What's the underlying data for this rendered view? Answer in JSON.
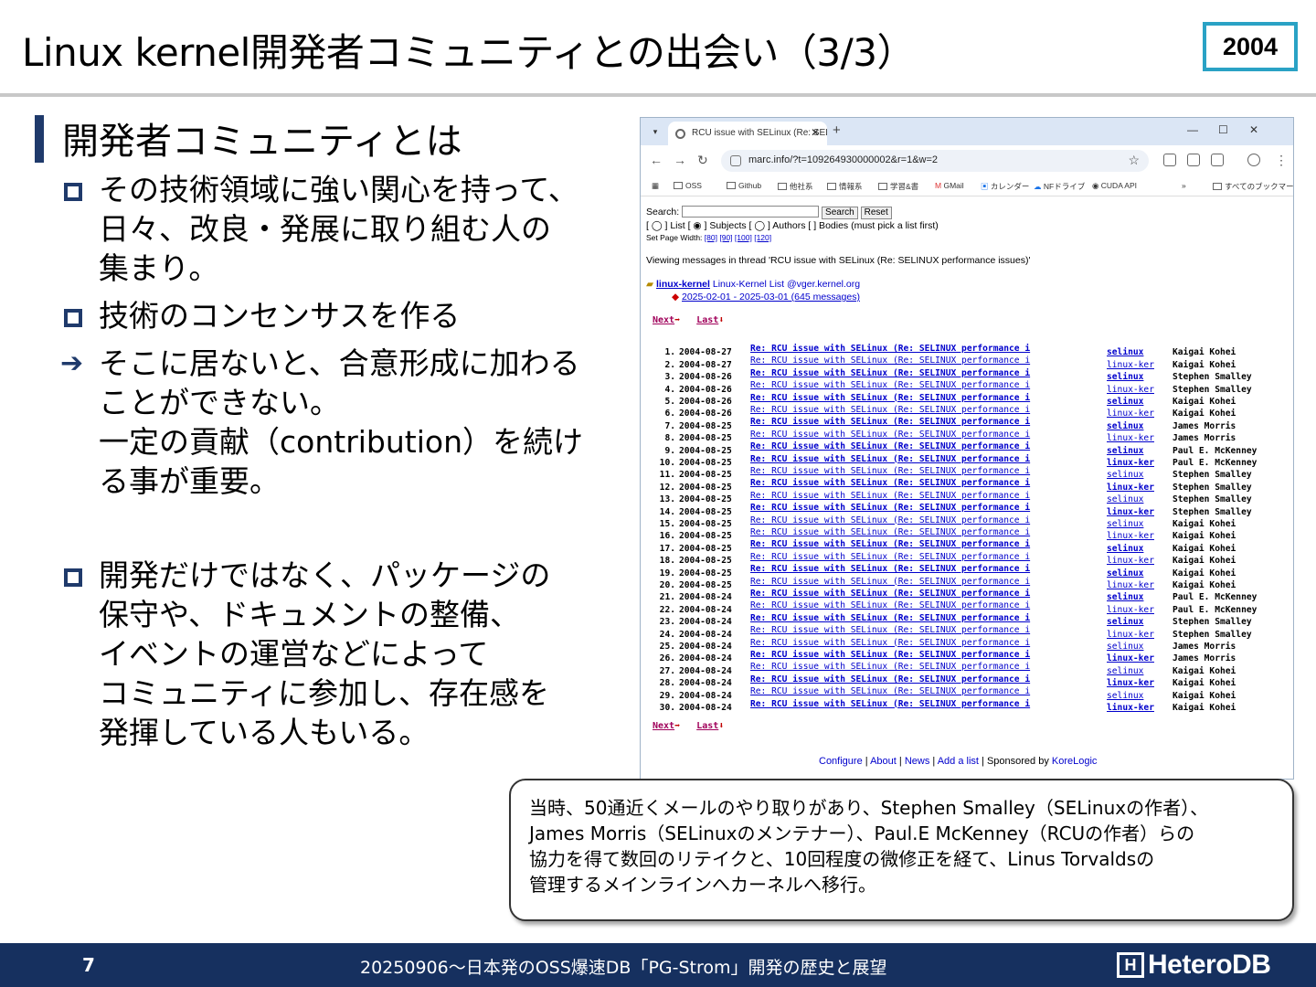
{
  "slide": {
    "title": "Linux kernel開発者コミュニティとの出会い（3/3）",
    "year_badge": "2004",
    "heading": "開発者コミュニティとは",
    "bullets": [
      {
        "lines": [
          "その技術領域に強い関心を持って、",
          "日々、改良・発展に取り組む人の",
          "集まり。"
        ]
      },
      {
        "lines": [
          "技術のコンセンサスを作る"
        ]
      },
      {
        "lines": [
          "そこに居ないと、合意形成に加わる",
          "ことができない。",
          "一定の貢献（contribution）を続け",
          "る事が重要。"
        ]
      },
      {
        "lines": [
          "開発だけではなく、パッケージの",
          "保守や、ドキュメントの整備、",
          "イベントの運営などによって",
          "コミュニティに参加し、存在感を",
          "発揮している人もいる。"
        ]
      }
    ],
    "callout_lines": [
      "当時、50通近くメールのやり取りがあり、Stephen Smalley（SELinuxの作者）、",
      "James Morris（SELinuxのメンテナー）、Paul.E McKenney（RCUの作者）らの",
      "協力を得て数回のリテイクと、10回程度の微修正を経て、Linus Torvaldsの",
      "管理するメインラインへカーネルへ移行。"
    ],
    "footer": {
      "page_number": "7",
      "text": "20250906～日本発のOSS爆速DB「PG-Strom」開発の歴史と展望",
      "logo_mark": "H",
      "logo_text": "HeteroDB"
    }
  },
  "browser": {
    "tab_title": "RCU issue with SELinux (Re: SELIN",
    "new_tab": "+",
    "url": "marc.info/?t=109264930000002&r=1&w=2",
    "window_controls": [
      "—",
      "☐",
      "✕"
    ],
    "bookmarks": [
      "OSS",
      "Github",
      "他社系",
      "情報系",
      "学習&書",
      "GMail",
      "カレンダー",
      "NFドライブ",
      "CUDA API",
      "すべてのブックマーク"
    ],
    "search_label": "Search:",
    "search_button": "Search",
    "reset_button": "Reset",
    "search_options": "[ ◯ ] List [ ◉ ] Subjects [ ◯ ] Authors [  ] Bodies (must pick a list first)",
    "page_width_label": "Set Page Width:",
    "page_widths": [
      "[80]",
      "[90]",
      "[100]",
      "[120]"
    ],
    "thread_heading": "Viewing messages in thread 'RCU issue with SELinux (Re: SELINUX performance issues)'",
    "list_name": "linux-kernel",
    "list_desc": "Linux-Kernel List @vger.kernel.org",
    "date_range": "2025-02-01 - 2025-03-01 (645 messages)",
    "next_label": "Next",
    "last_label": "Last",
    "messages": [
      {
        "num": "1.",
        "date": "2004-08-27",
        "subject": "Re: RCU issue with SELinux (Re: SELINUX performance i",
        "list": "selinux",
        "author": "Kaigai Kohei",
        "bold": true
      },
      {
        "num": "2.",
        "date": "2004-08-27",
        "subject": "Re: RCU issue with SELinux (Re: SELINUX performance i",
        "list": "linux-ker",
        "author": "Kaigai Kohei",
        "bold": false
      },
      {
        "num": "3.",
        "date": "2004-08-26",
        "subject": "Re: RCU issue with SELinux (Re: SELINUX performance i",
        "list": "selinux",
        "author": "Stephen Smalley",
        "bold": true
      },
      {
        "num": "4.",
        "date": "2004-08-26",
        "subject": "Re: RCU issue with SELinux (Re: SELINUX performance i",
        "list": "linux-ker",
        "author": "Stephen Smalley",
        "bold": false
      },
      {
        "num": "5.",
        "date": "2004-08-26",
        "subject": "Re: RCU issue with SELinux (Re: SELINUX performance i",
        "list": "selinux",
        "author": "Kaigai Kohei",
        "bold": true
      },
      {
        "num": "6.",
        "date": "2004-08-26",
        "subject": "Re: RCU issue with SELinux (Re: SELINUX performance i",
        "list": "linux-ker",
        "author": "Kaigai Kohei",
        "bold": false
      },
      {
        "num": "7.",
        "date": "2004-08-25",
        "subject": "Re: RCU issue with SELinux (Re: SELINUX performance i",
        "list": "selinux",
        "author": "James Morris",
        "bold": true
      },
      {
        "num": "8.",
        "date": "2004-08-25",
        "subject": "Re: RCU issue with SELinux (Re: SELINUX performance i",
        "list": "linux-ker",
        "author": "James Morris",
        "bold": false
      },
      {
        "num": "9.",
        "date": "2004-08-25",
        "subject": "Re: RCU issue with SELinux (Re: SELINUX performance i",
        "list": "selinux",
        "author": "Paul E. McKenney",
        "bold": true
      },
      {
        "num": "10.",
        "date": "2004-08-25",
        "subject": "Re: RCU issue with SELinux (Re: SELINUX performance i",
        "list": "linux-ker",
        "author": "Paul E. McKenney",
        "bold": true
      },
      {
        "num": "11.",
        "date": "2004-08-25",
        "subject": "Re: RCU issue with SELinux (Re: SELINUX performance i",
        "list": "selinux",
        "author": "Stephen Smalley",
        "bold": false
      },
      {
        "num": "12.",
        "date": "2004-08-25",
        "subject": "Re: RCU issue with SELinux (Re: SELINUX performance i",
        "list": "linux-ker",
        "author": "Stephen Smalley",
        "bold": true
      },
      {
        "num": "13.",
        "date": "2004-08-25",
        "subject": "Re: RCU issue with SELinux (Re: SELINUX performance i",
        "list": "selinux",
        "author": "Stephen Smalley",
        "bold": false
      },
      {
        "num": "14.",
        "date": "2004-08-25",
        "subject": "Re: RCU issue with SELinux (Re: SELINUX performance i",
        "list": "linux-ker",
        "author": "Stephen Smalley",
        "bold": true
      },
      {
        "num": "15.",
        "date": "2004-08-25",
        "subject": "Re: RCU issue with SELinux (Re: SELINUX performance i",
        "list": "selinux",
        "author": "Kaigai Kohei",
        "bold": false
      },
      {
        "num": "16.",
        "date": "2004-08-25",
        "subject": "Re: RCU issue with SELinux (Re: SELINUX performance i",
        "list": "linux-ker",
        "author": "Kaigai Kohei",
        "bold": false
      },
      {
        "num": "17.",
        "date": "2004-08-25",
        "subject": "Re: RCU issue with SELinux (Re: SELINUX performance i",
        "list": "selinux",
        "author": "Kaigai Kohei",
        "bold": true
      },
      {
        "num": "18.",
        "date": "2004-08-25",
        "subject": "Re: RCU issue with SELinux (Re: SELINUX performance i",
        "list": "linux-ker",
        "author": "Kaigai Kohei",
        "bold": false
      },
      {
        "num": "19.",
        "date": "2004-08-25",
        "subject": "Re: RCU issue with SELinux (Re: SELINUX performance i",
        "list": "selinux",
        "author": "Kaigai Kohei",
        "bold": true
      },
      {
        "num": "20.",
        "date": "2004-08-25",
        "subject": "Re: RCU issue with SELinux (Re: SELINUX performance i",
        "list": "linux-ker",
        "author": "Kaigai Kohei",
        "bold": false
      },
      {
        "num": "21.",
        "date": "2004-08-24",
        "subject": "Re: RCU issue with SELinux (Re: SELINUX performance i",
        "list": "selinux",
        "author": "Paul E. McKenney",
        "bold": true
      },
      {
        "num": "22.",
        "date": "2004-08-24",
        "subject": "Re: RCU issue with SELinux (Re: SELINUX performance i",
        "list": "linux-ker",
        "author": "Paul E. McKenney",
        "bold": false
      },
      {
        "num": "23.",
        "date": "2004-08-24",
        "subject": "Re: RCU issue with SELinux (Re: SELINUX performance i",
        "list": "selinux",
        "author": "Stephen Smalley",
        "bold": true
      },
      {
        "num": "24.",
        "date": "2004-08-24",
        "subject": "Re: RCU issue with SELinux (Re: SELINUX performance i",
        "list": "linux-ker",
        "author": "Stephen Smalley",
        "bold": false
      },
      {
        "num": "25.",
        "date": "2004-08-24",
        "subject": "Re: RCU issue with SELinux (Re: SELINUX performance i",
        "list": "selinux",
        "author": "James Morris",
        "bold": false
      },
      {
        "num": "26.",
        "date": "2004-08-24",
        "subject": "Re: RCU issue with SELinux (Re: SELINUX performance i",
        "list": "linux-ker",
        "author": "James Morris",
        "bold": true
      },
      {
        "num": "27.",
        "date": "2004-08-24",
        "subject": "Re: RCU issue with SELinux (Re: SELINUX performance i",
        "list": "selinux",
        "author": "Kaigai Kohei",
        "bold": false
      },
      {
        "num": "28.",
        "date": "2004-08-24",
        "subject": "Re: RCU issue with SELinux (Re: SELINUX performance i",
        "list": "linux-ker",
        "author": "Kaigai Kohei",
        "bold": true
      },
      {
        "num": "29.",
        "date": "2004-08-24",
        "subject": "Re: RCU issue with SELinux (Re: SELINUX performance i",
        "list": "selinux",
        "author": "Kaigai Kohei",
        "bold": false
      },
      {
        "num": "30.",
        "date": "2004-08-24",
        "subject": "Re: RCU issue with SELinux (Re: SELINUX performance i",
        "list": "linux-ker",
        "author": "Kaigai Kohei",
        "bold": true
      }
    ],
    "footer_links": [
      "Configure",
      "About",
      "News",
      "Add a list"
    ],
    "sponsored_label": "Sponsored by",
    "sponsor": "KoreLogic"
  }
}
